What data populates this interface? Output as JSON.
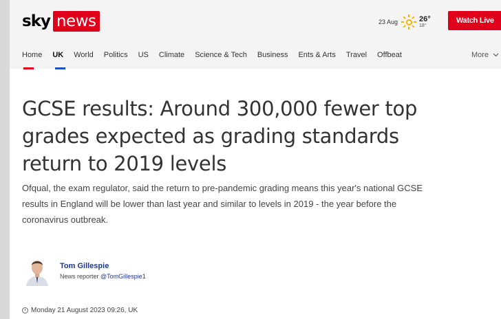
{
  "brand": {
    "sky": "sky",
    "news": "news"
  },
  "weather": {
    "date": "23 Aug",
    "icon": "sun-icon",
    "high": "26°",
    "low": "18°"
  },
  "watch_live": "Watch Live",
  "nav": {
    "items": [
      {
        "label": "Home"
      },
      {
        "label": "UK"
      },
      {
        "label": "World"
      },
      {
        "label": "Politics"
      },
      {
        "label": "US"
      },
      {
        "label": "Climate"
      },
      {
        "label": "Science & Tech"
      },
      {
        "label": "Business"
      },
      {
        "label": "Ents & Arts"
      },
      {
        "label": "Travel"
      },
      {
        "label": "Offbeat"
      }
    ],
    "more_label": "More",
    "active": "UK"
  },
  "article": {
    "headline": "GCSE results: Around 300,000 fewer top grades expected as grading standards return to 2019 levels",
    "standfirst": "Ofqual, the exam regulator, said the return to pre-pandemic grading means this year's national GCSE results in England will be lower than last year and similar to levels in 2019 - the year before the coronavirus outbreak.",
    "author": {
      "name": "Tom Gillespie",
      "role": "News reporter",
      "handle": "@TomGillespie1"
    },
    "timestamp": "Monday 21 August 2023 09:26, UK"
  },
  "colors": {
    "brand_red": "#e0001b",
    "link_blue": "#1a3a8e",
    "nav_underline_blue": "#1a52c6"
  }
}
